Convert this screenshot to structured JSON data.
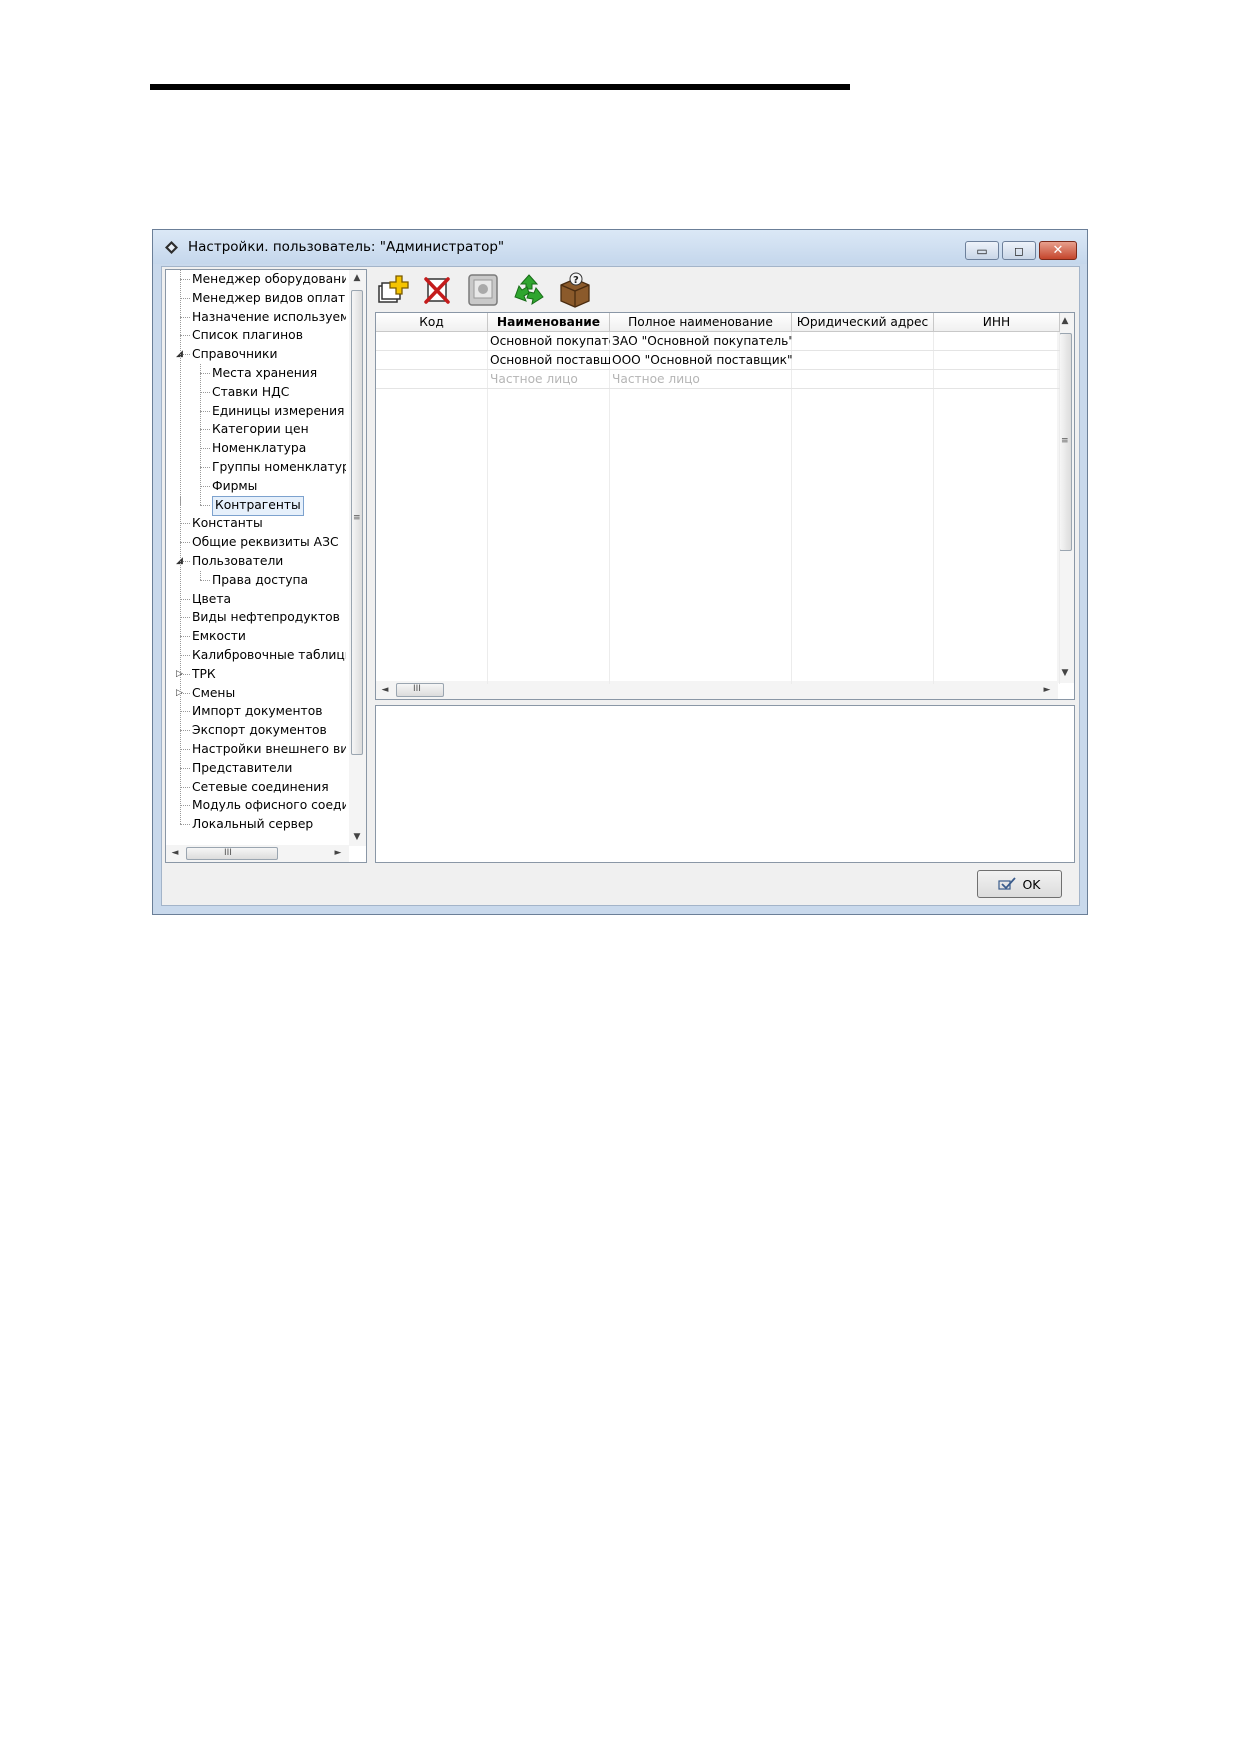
{
  "window": {
    "title": "Настройки. пользователь: \"Администратор\"",
    "controls": {
      "minimize": "▭",
      "maximize": "◻",
      "close": "✕"
    }
  },
  "tree": {
    "items": [
      {
        "label": "Менеджер оборудования",
        "level": 0
      },
      {
        "label": "Менеджер видов оплаты",
        "level": 0
      },
      {
        "label": "Назначение используемых",
        "level": 0
      },
      {
        "label": "Список плагинов",
        "level": 0
      },
      {
        "label": "Справочники",
        "level": 0,
        "expanded": true
      },
      {
        "label": "Места хранения",
        "level": 1
      },
      {
        "label": "Ставки НДС",
        "level": 1
      },
      {
        "label": "Единицы измерения",
        "level": 1
      },
      {
        "label": "Категории цен",
        "level": 1
      },
      {
        "label": "Номенклатура",
        "level": 1
      },
      {
        "label": "Группы номенклатуры",
        "level": 1
      },
      {
        "label": "Фирмы",
        "level": 1
      },
      {
        "label": "Контрагенты",
        "level": 1,
        "selected": true
      },
      {
        "label": "Константы",
        "level": 0
      },
      {
        "label": "Общие реквизиты АЗС",
        "level": 0
      },
      {
        "label": "Пользователи",
        "level": 0,
        "expanded": true
      },
      {
        "label": "Права доступа",
        "level": 1
      },
      {
        "label": "Цвета",
        "level": 0
      },
      {
        "label": "Виды нефтепродуктов",
        "level": 0
      },
      {
        "label": "Емкости",
        "level": 0
      },
      {
        "label": "Калибровочные таблицы",
        "level": 0
      },
      {
        "label": "ТРК",
        "level": 0,
        "collapsed": true
      },
      {
        "label": "Смены",
        "level": 0,
        "collapsed": true
      },
      {
        "label": "Импорт документов",
        "level": 0
      },
      {
        "label": "Экспорт документов",
        "level": 0
      },
      {
        "label": "Настройки внешнего вида",
        "level": 0
      },
      {
        "label": "Представители",
        "level": 0
      },
      {
        "label": "Сетевые соединения",
        "level": 0
      },
      {
        "label": "Модуль офисного соединения",
        "level": 0
      },
      {
        "label": "Локальный сервер",
        "level": 0
      }
    ]
  },
  "toolbar": {
    "buttons": [
      {
        "name": "add-icon"
      },
      {
        "name": "delete-icon"
      },
      {
        "name": "edit-icon"
      },
      {
        "name": "refresh-icon"
      },
      {
        "name": "help-box-icon"
      }
    ]
  },
  "grid": {
    "columns": [
      "Код",
      "Наименование",
      "Полное наименование",
      "Юридический адрес",
      "ИНН"
    ],
    "rows": [
      [
        "",
        "Основной покупатель",
        "ЗАО \"Основной покупатель\"",
        "",
        ""
      ],
      [
        "",
        "Основной поставщик",
        "ООО \"Основной поставщик\"",
        "",
        ""
      ]
    ],
    "placeholder_row": [
      "",
      "Частное лицо",
      "Частное лицо",
      "",
      ""
    ]
  },
  "scroll": {
    "grip": "≡",
    "hgrip": "III",
    "up": "▲",
    "down": "▼",
    "left": "◄",
    "right": "►"
  },
  "ok_label": "OK"
}
